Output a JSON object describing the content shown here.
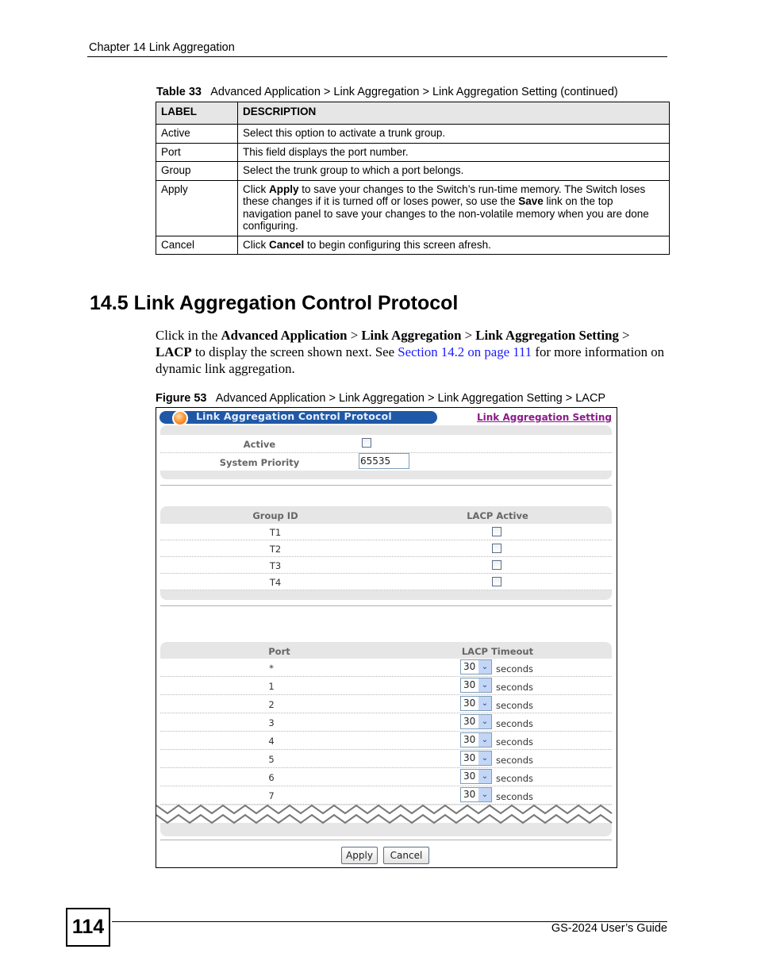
{
  "running_header": "Chapter 14 Link Aggregation",
  "table": {
    "caption_number": "Table 33",
    "caption_text": "Advanced Application > Link Aggregation > Link Aggregation Setting  (continued)",
    "headers": [
      "LABEL",
      "DESCRIPTION"
    ],
    "rows": [
      {
        "label": "Active",
        "desc_pre": "Select this option to activate a trunk group.",
        "desc_bold1": "",
        "desc_mid": "",
        "desc_bold2": "",
        "desc_post": ""
      },
      {
        "label": "Port",
        "desc_pre": "This field displays the port number.",
        "desc_bold1": "",
        "desc_mid": "",
        "desc_bold2": "",
        "desc_post": ""
      },
      {
        "label": "Group",
        "desc_pre": "Select the trunk group to which a port belongs.",
        "desc_bold1": "",
        "desc_mid": "",
        "desc_bold2": "",
        "desc_post": ""
      },
      {
        "label": "Apply",
        "desc_pre": "Click ",
        "desc_bold1": "Apply",
        "desc_mid": " to save your changes to the Switch’s run-time memory. The Switch loses these changes if it is turned off or loses power, so use the ",
        "desc_bold2": "Save",
        "desc_post": " link on the top navigation panel to save your changes to the non-volatile memory when you are done configuring."
      },
      {
        "label": "Cancel",
        "desc_pre": "Click ",
        "desc_bold1": "Cancel",
        "desc_mid": " to begin configuring this screen afresh.",
        "desc_bold2": "",
        "desc_post": ""
      }
    ]
  },
  "section": {
    "title": "14.5  Link Aggregation Control Protocol",
    "para": {
      "t1": "Click in the ",
      "b1": "Advanced Application",
      "t2": " > ",
      "b2": "Link Aggregation",
      "t3": " > ",
      "b3": "Link Aggregation Setting",
      "t4": " > ",
      "b4": "LACP",
      "t5": " to display the screen shown next. See ",
      "link": "Section 14.2 on page 111",
      "t6": " for more information on dynamic link aggregation."
    }
  },
  "figure": {
    "caption_number": "Figure 53",
    "caption_text": "Advanced Application > Link Aggregation > Link Aggregation Setting > LACP",
    "screen": {
      "title": "Link Aggregation Control Protocol",
      "top_link": "Link Aggregation Setting",
      "active_label": "Active",
      "active_checked": false,
      "system_priority_label": "System Priority",
      "system_priority_value": "65535",
      "group_table": {
        "headers": [
          "Group ID",
          "LACP Active"
        ],
        "rows": [
          {
            "id": "T1",
            "checked": false
          },
          {
            "id": "T2",
            "checked": false
          },
          {
            "id": "T3",
            "checked": false
          },
          {
            "id": "T4",
            "checked": false
          }
        ]
      },
      "port_table": {
        "headers": [
          "Port",
          "LACP Timeout"
        ],
        "unit": "seconds",
        "rows": [
          {
            "port": "*",
            "timeout": "30"
          },
          {
            "port": "1",
            "timeout": "30"
          },
          {
            "port": "2",
            "timeout": "30"
          },
          {
            "port": "3",
            "timeout": "30"
          },
          {
            "port": "4",
            "timeout": "30"
          },
          {
            "port": "5",
            "timeout": "30"
          },
          {
            "port": "6",
            "timeout": "30"
          },
          {
            "port": "7",
            "timeout": "30"
          }
        ]
      },
      "buttons": {
        "apply": "Apply",
        "cancel": "Cancel"
      }
    }
  },
  "footer": {
    "page_number": "114",
    "guide_title": "GS-2024 User’s Guide"
  }
}
